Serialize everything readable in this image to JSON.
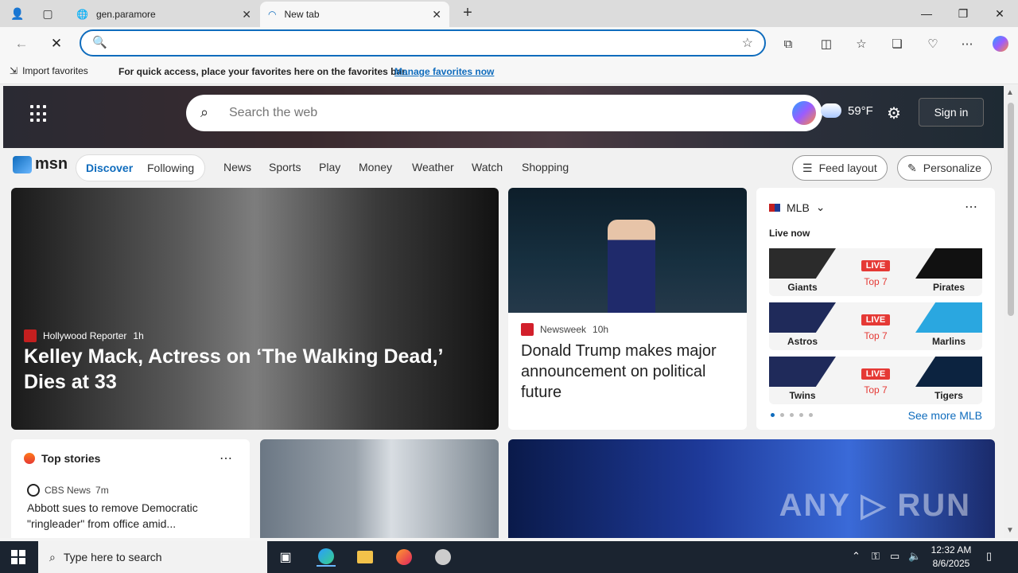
{
  "browser": {
    "tabs": [
      {
        "title": "gen.paramore",
        "active": false
      },
      {
        "title": "New tab",
        "active": true
      }
    ],
    "address_placeholder": "",
    "favorites_bar": {
      "import_label": "Import favorites",
      "hint": "For quick access, place your favorites here on the favorites bar.",
      "manage_link": "Manage favorites now"
    }
  },
  "page": {
    "search_placeholder": "Search the web",
    "weather_temp": "59°F",
    "signin_label": "Sign in",
    "logo_text": "msn",
    "nav": {
      "discover": "Discover",
      "following": "Following",
      "items": [
        "News",
        "Sports",
        "Play",
        "Money",
        "Weather",
        "Watch",
        "Shopping"
      ],
      "feed_layout": "Feed layout",
      "personalize": "Personalize"
    },
    "hero_story": {
      "source": "Hollywood Reporter",
      "age": "1h",
      "title": "Kelley Mack, Actress on ‘The Walking Dead,’ Dies at 33"
    },
    "mid_story": {
      "source": "Newsweek",
      "age": "10h",
      "title": "Donald Trump makes major announcement on political future"
    },
    "mlb": {
      "title": "MLB",
      "live_now": "Live now",
      "games": [
        {
          "away": "Giants",
          "home": "Pirates",
          "status": "LIVE",
          "inning": "Top 7",
          "away_color": "#2b2b2b",
          "home_color": "#111111"
        },
        {
          "away": "Astros",
          "home": "Marlins",
          "status": "LIVE",
          "inning": "Top 7",
          "away_color": "#1f2a5a",
          "home_color": "#2aa7e0"
        },
        {
          "away": "Twins",
          "home": "Tigers",
          "status": "LIVE",
          "inning": "Top 7",
          "away_color": "#1f2a5a",
          "home_color": "#0c2340"
        }
      ],
      "see_more": "See more MLB"
    },
    "top_stories": {
      "title": "Top stories",
      "source": "CBS News",
      "age": "7m",
      "headline": "Abbott sues to remove Democratic \"ringleader\" from office amid..."
    }
  },
  "taskbar": {
    "search_placeholder": "Type here to search",
    "time": "12:32 AM",
    "date": "8/6/2025"
  }
}
